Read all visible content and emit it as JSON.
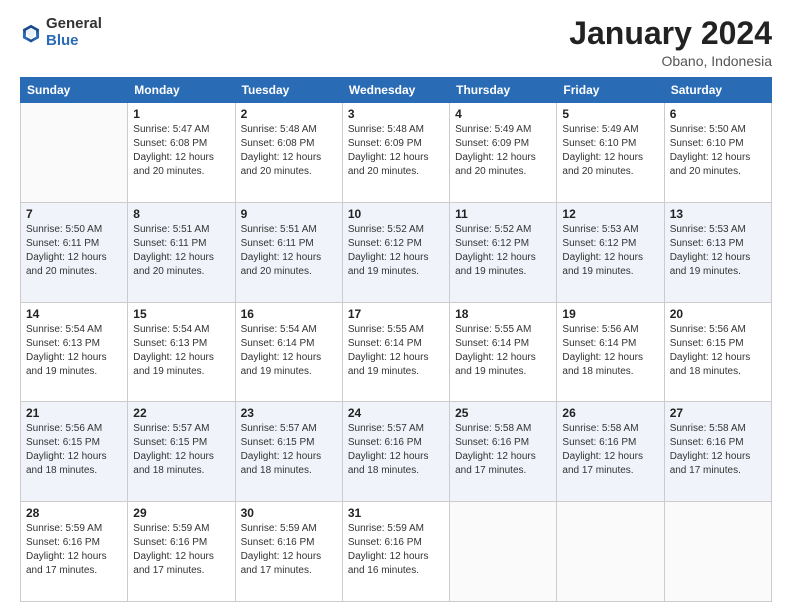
{
  "header": {
    "logo": {
      "general": "General",
      "blue": "Blue"
    },
    "title": "January 2024",
    "location": "Obano, Indonesia"
  },
  "days_of_week": [
    "Sunday",
    "Monday",
    "Tuesday",
    "Wednesday",
    "Thursday",
    "Friday",
    "Saturday"
  ],
  "weeks": [
    [
      {
        "num": "",
        "info": ""
      },
      {
        "num": "1",
        "info": "Sunrise: 5:47 AM\nSunset: 6:08 PM\nDaylight: 12 hours\nand 20 minutes."
      },
      {
        "num": "2",
        "info": "Sunrise: 5:48 AM\nSunset: 6:08 PM\nDaylight: 12 hours\nand 20 minutes."
      },
      {
        "num": "3",
        "info": "Sunrise: 5:48 AM\nSunset: 6:09 PM\nDaylight: 12 hours\nand 20 minutes."
      },
      {
        "num": "4",
        "info": "Sunrise: 5:49 AM\nSunset: 6:09 PM\nDaylight: 12 hours\nand 20 minutes."
      },
      {
        "num": "5",
        "info": "Sunrise: 5:49 AM\nSunset: 6:10 PM\nDaylight: 12 hours\nand 20 minutes."
      },
      {
        "num": "6",
        "info": "Sunrise: 5:50 AM\nSunset: 6:10 PM\nDaylight: 12 hours\nand 20 minutes."
      }
    ],
    [
      {
        "num": "7",
        "info": "Sunrise: 5:50 AM\nSunset: 6:11 PM\nDaylight: 12 hours\nand 20 minutes."
      },
      {
        "num": "8",
        "info": "Sunrise: 5:51 AM\nSunset: 6:11 PM\nDaylight: 12 hours\nand 20 minutes."
      },
      {
        "num": "9",
        "info": "Sunrise: 5:51 AM\nSunset: 6:11 PM\nDaylight: 12 hours\nand 20 minutes."
      },
      {
        "num": "10",
        "info": "Sunrise: 5:52 AM\nSunset: 6:12 PM\nDaylight: 12 hours\nand 19 minutes."
      },
      {
        "num": "11",
        "info": "Sunrise: 5:52 AM\nSunset: 6:12 PM\nDaylight: 12 hours\nand 19 minutes."
      },
      {
        "num": "12",
        "info": "Sunrise: 5:53 AM\nSunset: 6:12 PM\nDaylight: 12 hours\nand 19 minutes."
      },
      {
        "num": "13",
        "info": "Sunrise: 5:53 AM\nSunset: 6:13 PM\nDaylight: 12 hours\nand 19 minutes."
      }
    ],
    [
      {
        "num": "14",
        "info": "Sunrise: 5:54 AM\nSunset: 6:13 PM\nDaylight: 12 hours\nand 19 minutes."
      },
      {
        "num": "15",
        "info": "Sunrise: 5:54 AM\nSunset: 6:13 PM\nDaylight: 12 hours\nand 19 minutes."
      },
      {
        "num": "16",
        "info": "Sunrise: 5:54 AM\nSunset: 6:14 PM\nDaylight: 12 hours\nand 19 minutes."
      },
      {
        "num": "17",
        "info": "Sunrise: 5:55 AM\nSunset: 6:14 PM\nDaylight: 12 hours\nand 19 minutes."
      },
      {
        "num": "18",
        "info": "Sunrise: 5:55 AM\nSunset: 6:14 PM\nDaylight: 12 hours\nand 19 minutes."
      },
      {
        "num": "19",
        "info": "Sunrise: 5:56 AM\nSunset: 6:14 PM\nDaylight: 12 hours\nand 18 minutes."
      },
      {
        "num": "20",
        "info": "Sunrise: 5:56 AM\nSunset: 6:15 PM\nDaylight: 12 hours\nand 18 minutes."
      }
    ],
    [
      {
        "num": "21",
        "info": "Sunrise: 5:56 AM\nSunset: 6:15 PM\nDaylight: 12 hours\nand 18 minutes."
      },
      {
        "num": "22",
        "info": "Sunrise: 5:57 AM\nSunset: 6:15 PM\nDaylight: 12 hours\nand 18 minutes."
      },
      {
        "num": "23",
        "info": "Sunrise: 5:57 AM\nSunset: 6:15 PM\nDaylight: 12 hours\nand 18 minutes."
      },
      {
        "num": "24",
        "info": "Sunrise: 5:57 AM\nSunset: 6:16 PM\nDaylight: 12 hours\nand 18 minutes."
      },
      {
        "num": "25",
        "info": "Sunrise: 5:58 AM\nSunset: 6:16 PM\nDaylight: 12 hours\nand 17 minutes."
      },
      {
        "num": "26",
        "info": "Sunrise: 5:58 AM\nSunset: 6:16 PM\nDaylight: 12 hours\nand 17 minutes."
      },
      {
        "num": "27",
        "info": "Sunrise: 5:58 AM\nSunset: 6:16 PM\nDaylight: 12 hours\nand 17 minutes."
      }
    ],
    [
      {
        "num": "28",
        "info": "Sunrise: 5:59 AM\nSunset: 6:16 PM\nDaylight: 12 hours\nand 17 minutes."
      },
      {
        "num": "29",
        "info": "Sunrise: 5:59 AM\nSunset: 6:16 PM\nDaylight: 12 hours\nand 17 minutes."
      },
      {
        "num": "30",
        "info": "Sunrise: 5:59 AM\nSunset: 6:16 PM\nDaylight: 12 hours\nand 17 minutes."
      },
      {
        "num": "31",
        "info": "Sunrise: 5:59 AM\nSunset: 6:16 PM\nDaylight: 12 hours\nand 16 minutes."
      },
      {
        "num": "",
        "info": ""
      },
      {
        "num": "",
        "info": ""
      },
      {
        "num": "",
        "info": ""
      }
    ]
  ]
}
